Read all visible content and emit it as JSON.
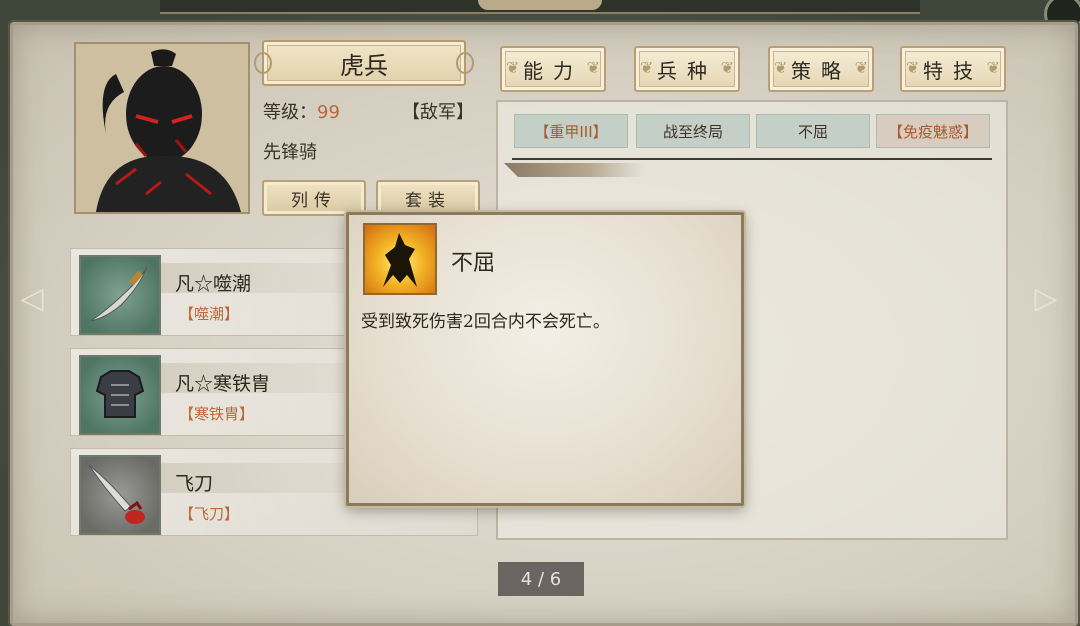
{
  "header": {
    "name": "虎兵"
  },
  "info": {
    "level_label": "等级：",
    "level_value": "99",
    "faction": "【敌军】",
    "unit_type": "先锋骑"
  },
  "buttons": {
    "biography": "列传",
    "set": "套装"
  },
  "tabs": [
    {
      "label": "能力"
    },
    {
      "label": "兵种"
    },
    {
      "label": "策略"
    },
    {
      "label": "特技"
    }
  ],
  "skills": [
    {
      "label": "【重甲III】"
    },
    {
      "label": "战至终局"
    },
    {
      "label": "不屈"
    },
    {
      "label": "【免疫魅惑】"
    }
  ],
  "equipment": [
    {
      "name": "凡☆噬潮",
      "sub": "【噬潮】",
      "icon": "curved-blade-icon"
    },
    {
      "name": "凡☆寒铁胄",
      "sub": "【寒铁胄】",
      "icon": "armor-icon"
    },
    {
      "name": "飞刀",
      "sub": "【飞刀】",
      "icon": "throwing-knife-icon"
    }
  ],
  "popup": {
    "title": "不屈",
    "description": "受到致死伤害2回合内不会死亡。",
    "icon": "flame-warrior-icon"
  },
  "pager": {
    "text": "4 / 6"
  },
  "colors": {
    "accent": "#b86a3a",
    "panel": "#e1dccf",
    "chip": "#c4d0c7"
  }
}
